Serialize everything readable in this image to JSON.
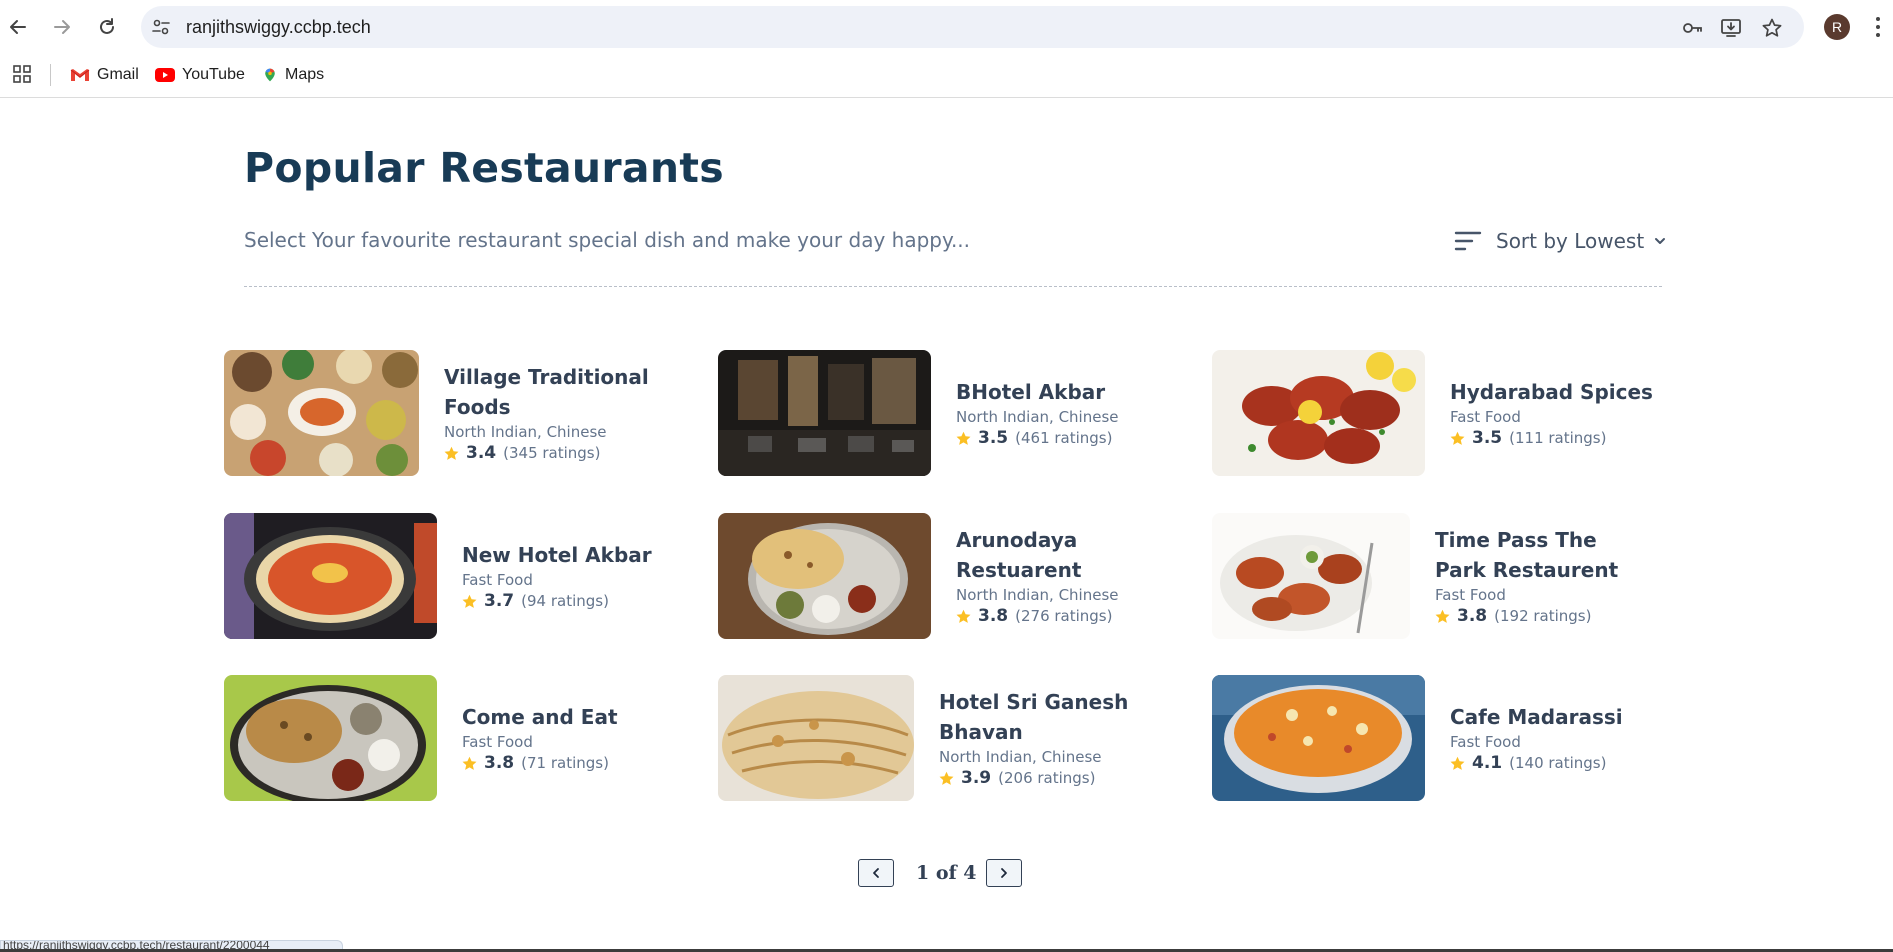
{
  "browser": {
    "url": "ranjithswiggy.ccbp.tech",
    "profile_initial": "R",
    "bookmarks": [
      {
        "label": "Gmail",
        "icon": "gmail-icon"
      },
      {
        "label": "YouTube",
        "icon": "youtube-icon"
      },
      {
        "label": "Maps",
        "icon": "maps-icon"
      }
    ],
    "status_url": "https://ranjithswiggy.ccbp.tech/restaurant/2200044"
  },
  "page": {
    "title": "Popular Restaurants",
    "subtitle": "Select Your favourite restaurant special dish and make your day happy...",
    "sort_label": "Sort by Lowest"
  },
  "restaurants": [
    {
      "name": "Village Traditional Foods",
      "cuisine": "North Indian, Chinese",
      "rating": "3.4",
      "ratings_count": "(345 ratings)",
      "image": "thali-spread-image"
    },
    {
      "name": "BHotel Akbar",
      "cuisine": "North Indian, Chinese",
      "rating": "3.5",
      "ratings_count": "(461 ratings)",
      "image": "restaurant-interior-image"
    },
    {
      "name": "Hydarabad Spices",
      "cuisine": "Fast Food",
      "rating": "3.5",
      "ratings_count": "(111 ratings)",
      "image": "tandoori-chicken-image"
    },
    {
      "name": "New Hotel Akbar",
      "cuisine": "Fast Food",
      "rating": "3.7",
      "ratings_count": "(94 ratings)",
      "image": "pav-bhaji-tawa-image"
    },
    {
      "name": "Arunodaya Restuarent",
      "cuisine": "North Indian, Chinese",
      "rating": "3.8",
      "ratings_count": "(276 ratings)",
      "image": "naan-thali-image"
    },
    {
      "name": "Time Pass The Park Restaurent",
      "cuisine": "Fast Food",
      "rating": "3.8",
      "ratings_count": "(192 ratings)",
      "image": "chicken-legs-image"
    },
    {
      "name": "Come and Eat",
      "cuisine": "Fast Food",
      "rating": "3.8",
      "ratings_count": "(71 ratings)",
      "image": "paratha-plate-image"
    },
    {
      "name": "Hotel Sri Ganesh Bhavan",
      "cuisine": "North Indian, Chinese",
      "rating": "3.9",
      "ratings_count": "(206 ratings)",
      "image": "parotta-image"
    },
    {
      "name": "Cafe Madarassi",
      "cuisine": "Fast Food",
      "rating": "4.1",
      "ratings_count": "(140 ratings)",
      "image": "kesari-bowl-image"
    }
  ],
  "pagination": {
    "text": "1 of 4"
  },
  "colors": {
    "title": "#183b56",
    "text_primary": "#334155",
    "text_secondary": "#64748b",
    "star": "#fbbf24",
    "omnibox_bg": "#eef1f8"
  }
}
